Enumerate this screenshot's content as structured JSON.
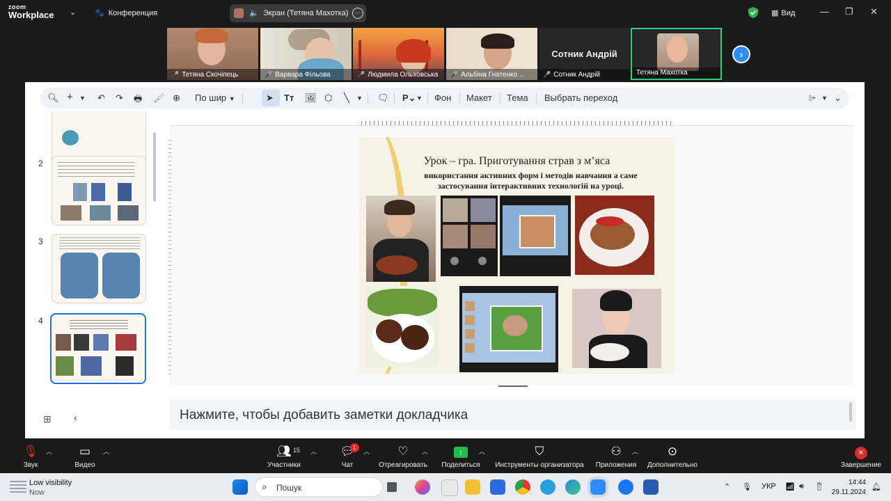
{
  "topbar": {
    "brand_line1": "zoom",
    "brand_line2": "Workplace",
    "meeting_label": "Конференция",
    "share_label": "Экран (Тетяна Махотка)",
    "view_label": "Вид",
    "colors": {
      "shield": "#2fb350",
      "accent": "#2d8cff"
    }
  },
  "gallery": {
    "participants": [
      {
        "name": "Тетяна Скочіпець",
        "muted": true
      },
      {
        "name": "Варвара Фільова",
        "muted": true
      },
      {
        "name": "Людмила Ольховська",
        "muted": true
      },
      {
        "name": "Альбіна Гнатенко ...",
        "muted": true
      },
      {
        "name": "Сотник Андрій",
        "muted": true,
        "display_text": "Сотник Андрій"
      },
      {
        "name": "Тетяна Махотка",
        "muted": false,
        "active": true
      }
    ]
  },
  "editor": {
    "toolbar": {
      "zoom_mode": "По шир",
      "background": "Фон",
      "layout": "Макет",
      "theme": "Тема",
      "transition": "Выбрать переход"
    },
    "slide_numbers": [
      "2",
      "3",
      "4"
    ],
    "current_slide": {
      "title": "Урок – гра. Приготування страв з мʼяса",
      "subtitle_line1": "використання активних форм і методів навчання а саме",
      "subtitle_line2": "застосування інтерактивних технологій на уроці."
    },
    "notes_placeholder": "Нажмите, чтобы добавить заметки докладчика"
  },
  "controls": {
    "audio": "Звук",
    "video": "Видео",
    "participants": "Участники",
    "participants_count": "15",
    "chat": "Чат",
    "chat_badge": "1",
    "react": "Отреагировать",
    "share": "Поделиться",
    "host_tools": "Инструменты организатора",
    "apps": "Приложения",
    "more": "Дополнительно",
    "end": "Завершение"
  },
  "taskbar": {
    "weather_title": "Low visibility",
    "weather_sub": "Now",
    "search_placeholder": "Пошук",
    "language": "УКР",
    "time": "14:44",
    "date": "29.11.2024"
  }
}
